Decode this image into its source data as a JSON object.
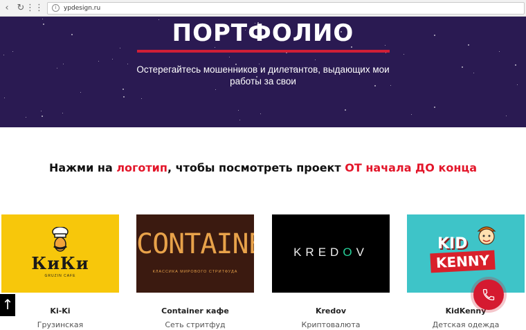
{
  "browser": {
    "url": "ypdesign.ru"
  },
  "hero": {
    "title": "ПОРТФОЛИО",
    "subtitle": "Остерегайтесь мошенников и дилетантов, выдающих мои работы за свои"
  },
  "headline": {
    "part1": "Нажми на ",
    "part2": "логотип",
    "part3": ", чтобы посмотреть проект ",
    "part4": "ОТ начала ДО конца"
  },
  "projects": [
    {
      "title": "Ki-Ki",
      "category": "Грузинская",
      "logo_text": "КиКи",
      "logo_small": "GRUZIN CAFE"
    },
    {
      "title": "Container кафе",
      "category": "Сеть стритфуд",
      "logo_text": "CONTAINER",
      "logo_small": "КЛАССИКА МИРОВОГО СТРИТФУДА"
    },
    {
      "title": "Kredov",
      "category": "Криптовалюта",
      "logo_text_a": "KRED",
      "logo_text_b": "O",
      "logo_text_c": "V"
    },
    {
      "title": "KidKenny",
      "category": "Детская одежда",
      "logo_text_1": "KID",
      "logo_text_2": "KENNY"
    }
  ],
  "colors": {
    "hero_bg": "#2a1a52",
    "accent_red": "#e3162a",
    "call_button": "#d51a30"
  }
}
